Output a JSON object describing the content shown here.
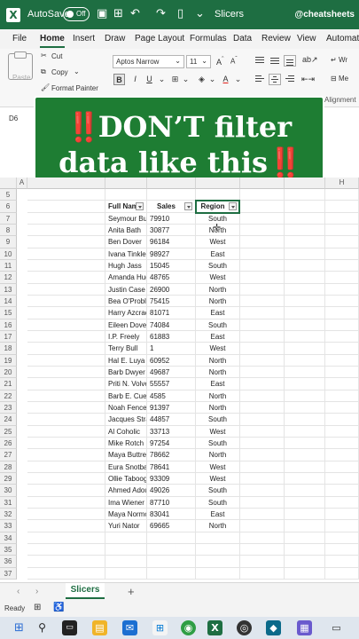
{
  "titlebar": {
    "autosave_label": "AutoSave",
    "autosave_state": "Off",
    "title": "Slicers",
    "handle": "@cheatsheets"
  },
  "menu": {
    "tabs": [
      "File",
      "Home",
      "Insert",
      "Draw",
      "Page Layout",
      "Formulas",
      "Data",
      "Review",
      "View",
      "Automate"
    ],
    "active": "Home"
  },
  "ribbon": {
    "cut": "Cut",
    "copy": "Copy",
    "format_painter": "Format Painter",
    "paste": "Paste",
    "font_name": "Aptos Narrow",
    "font_size": "11",
    "alignment_group": "Alignment",
    "wrap": "Wr",
    "merge": "Me"
  },
  "name_box": "D6",
  "banner": {
    "line1": "DON’T filter",
    "line2": "data like this",
    "bangs": "‼️"
  },
  "columns": [
    "A",
    "H"
  ],
  "table": {
    "headers": [
      "Full Name",
      "Sales",
      "Region"
    ],
    "header_row": 6,
    "first_row_number": 5,
    "rows": [
      [
        "Seymour Butz",
        "79910",
        "South"
      ],
      [
        "Anita Bath",
        "30877",
        "North"
      ],
      [
        "Ben Dover",
        "96184",
        "West"
      ],
      [
        "Ivana Tinkle",
        "98927",
        "East"
      ],
      [
        "Hugh Jass",
        "15045",
        "South"
      ],
      [
        "Amanda Hugginkiss",
        "48765",
        "West"
      ],
      [
        "Justin Case",
        "26900",
        "North"
      ],
      [
        "Bea O'Problem",
        "75415",
        "North"
      ],
      [
        "Harry Azcrac",
        "81071",
        "East"
      ],
      [
        "Eileen Dover",
        "74084",
        "South"
      ],
      [
        "I.P. Freely",
        "61883",
        "East"
      ],
      [
        "Terry Bull",
        "1",
        "West"
      ],
      [
        "Hal E. Luya",
        "60952",
        "North"
      ],
      [
        "Barb Dwyer",
        "49687",
        "North"
      ],
      [
        "Priti N. Volved",
        "55557",
        "East"
      ],
      [
        "Barb E. Cue",
        "4585",
        "North"
      ],
      [
        "Noah Fence",
        "91397",
        "North"
      ],
      [
        "Jacques Strappe",
        "44857",
        "South"
      ],
      [
        "Al Coholic",
        "33713",
        "West"
      ],
      [
        "Mike Rotch",
        "97254",
        "South"
      ],
      [
        "Maya Buttreeks",
        "78662",
        "North"
      ],
      [
        "Eura Snotball",
        "78641",
        "West"
      ],
      [
        "Ollie Tabooger",
        "93309",
        "West"
      ],
      [
        "Ahmed Adoudi",
        "49026",
        "South"
      ],
      [
        "Ima Wiener",
        "87710",
        "South"
      ],
      [
        "Maya Normousbutt",
        "83041",
        "East"
      ],
      [
        "Yuri Nator",
        "69665",
        "North"
      ]
    ],
    "trailing_rows": [
      34,
      35,
      36,
      37
    ]
  },
  "sheets": {
    "tabs": [
      "Slicers"
    ],
    "add": "+"
  },
  "status": {
    "text": "Ready"
  },
  "colors": {
    "excel_green": "#1e6e42",
    "banner_green": "#1e7d33",
    "bang_red": "#e0221c"
  }
}
